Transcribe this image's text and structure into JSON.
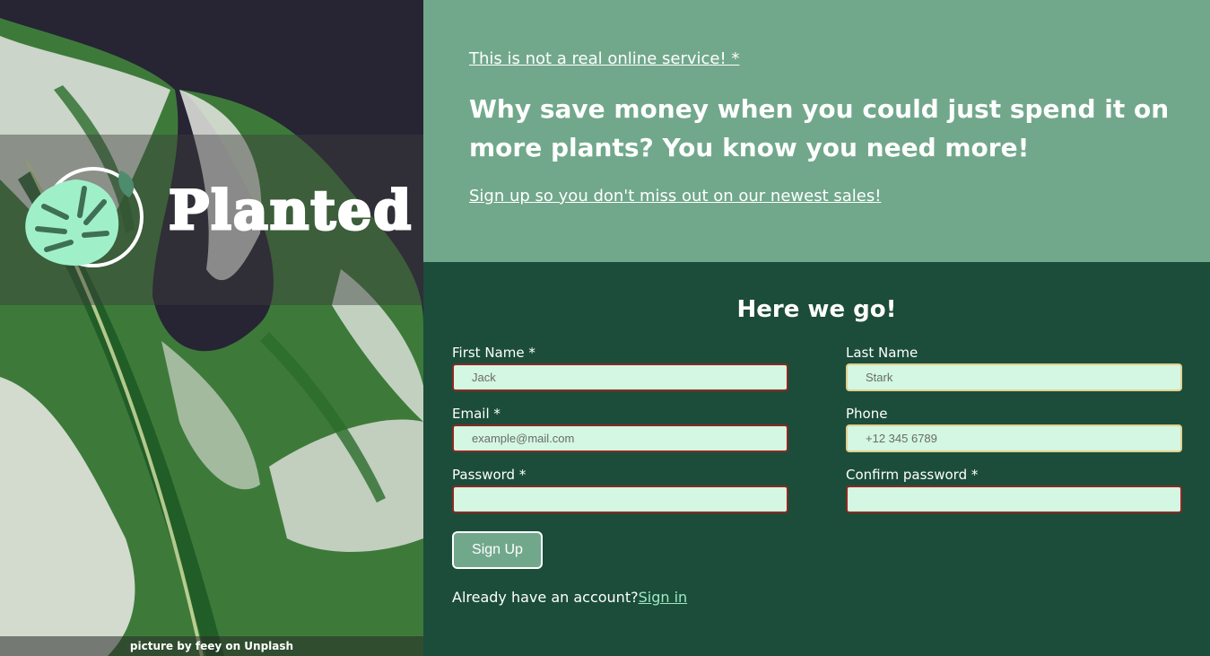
{
  "brand": {
    "name": "Planted",
    "logo_icon": "monstera-leaf-icon",
    "photo_credit": "picture by feey on Unplash"
  },
  "hero": {
    "disclaimer": "This is not a real online service! *",
    "headline": "Why save money when you could just spend it on more plants? You know you need more!",
    "signup_tagline": "Sign up so you don't miss out on our newest sales!"
  },
  "form": {
    "title": "Here we go!",
    "fields": {
      "first_name": {
        "label": "First Name *",
        "placeholder": "Jack",
        "value": ""
      },
      "last_name": {
        "label": "Last Name",
        "placeholder": "Stark",
        "value": ""
      },
      "email": {
        "label": "Email *",
        "placeholder": "example@mail.com",
        "value": ""
      },
      "phone": {
        "label": "Phone",
        "placeholder": "+12 345 6789",
        "value": ""
      },
      "password": {
        "label": "Password *",
        "placeholder": "",
        "value": ""
      },
      "confirm_password": {
        "label": "Confirm password *",
        "placeholder": "",
        "value": ""
      }
    },
    "submit_label": "Sign Up",
    "account_prompt": "Already have an account?",
    "signin_link": "Sign in"
  },
  "colors": {
    "hero_bg": "#71a88b",
    "form_bg": "#1b4d3a",
    "input_bg": "#d3f7e2",
    "invalid_border": "#8c2a22",
    "valid_border": "#e3d08c",
    "link_accent": "#9fe8c4",
    "logo_mint": "#9ff0c8"
  }
}
